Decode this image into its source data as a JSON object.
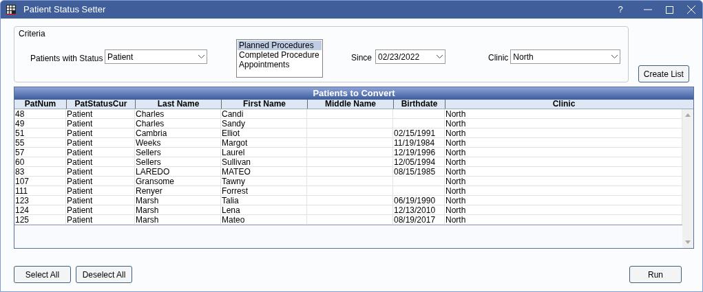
{
  "window": {
    "title": "Patient Status Setter",
    "controls": [
      "?"
    ]
  },
  "criteria": {
    "title": "Criteria",
    "status_label": "Patients with Status",
    "status_value": "Patient",
    "types": [
      {
        "label": "Planned Procedures",
        "selected": true
      },
      {
        "label": "Completed Procedure",
        "selected": false
      },
      {
        "label": "Appointments",
        "selected": false
      }
    ],
    "since_label": "Since",
    "since_value": "02/23/2022",
    "clinic_label": "Clinic",
    "clinic_value": "North"
  },
  "create_button": "Create List",
  "table": {
    "title": "Patients to Convert",
    "columns": [
      "PatNum",
      "PatStatusCur",
      "Last Name",
      "First Name",
      "Middle Name",
      "Birthdate",
      "Clinic"
    ],
    "rows": [
      [
        "48",
        "Patient",
        "Charles",
        "Candi",
        "",
        "",
        "North"
      ],
      [
        "49",
        "Patient",
        "Charles",
        "Sandy",
        "",
        "",
        "North"
      ],
      [
        "51",
        "Patient",
        "Cambria",
        "Elliot",
        "",
        "02/15/1991",
        "North"
      ],
      [
        "55",
        "Patient",
        "Weeks",
        "Margot",
        "",
        "11/19/1984",
        "North"
      ],
      [
        "57",
        "Patient",
        "Sellers",
        "Laurel",
        "",
        "12/19/1996",
        "North"
      ],
      [
        "60",
        "Patient",
        "Sellers",
        "Sullivan",
        "",
        "12/05/1994",
        "North"
      ],
      [
        "83",
        "Patient",
        "LAREDO",
        "MATEO",
        "",
        "08/15/1985",
        "North"
      ],
      [
        "107",
        "Patient",
        "Gransome",
        "Tawny",
        "",
        "",
        "North"
      ],
      [
        "111",
        "Patient",
        "Renyer",
        "Forrest",
        "",
        "",
        "North"
      ],
      [
        "123",
        "Patient",
        "Marsh",
        "Talia",
        "",
        "06/19/1990",
        "North"
      ],
      [
        "124",
        "Patient",
        "Marsh",
        "Lena",
        "",
        "12/13/2010",
        "North"
      ],
      [
        "125",
        "Patient",
        "Marsh",
        "Mateo",
        "",
        "08/19/2017",
        "North"
      ]
    ]
  },
  "buttons": [
    "Select All",
    "Deselect All",
    "Run"
  ]
}
